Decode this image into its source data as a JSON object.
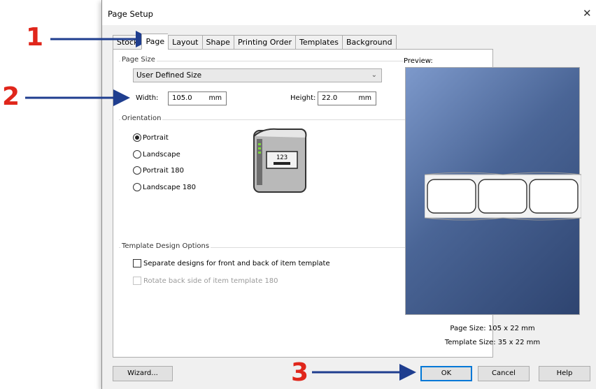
{
  "dialog": {
    "title": "Page Setup",
    "close_glyph": "✕"
  },
  "tabs": [
    {
      "label": "Stock",
      "active": false
    },
    {
      "label": "Page",
      "active": true
    },
    {
      "label": "Layout",
      "active": false
    },
    {
      "label": "Shape",
      "active": false
    },
    {
      "label": "Printing Order",
      "active": false
    },
    {
      "label": "Templates",
      "active": false
    },
    {
      "label": "Background",
      "active": false
    }
  ],
  "page_size": {
    "group_label": "Page Size",
    "selected": "User Defined Size",
    "width_label": "Width:",
    "width_value": "105.0",
    "width_unit": "mm",
    "height_label": "Height:",
    "height_value": "22.0",
    "height_unit": "mm"
  },
  "orientation": {
    "group_label": "Orientation",
    "options": [
      {
        "label": "Portrait",
        "selected": true
      },
      {
        "label": "Landscape",
        "selected": false
      },
      {
        "label": "Portrait 180",
        "selected": false
      },
      {
        "label": "Landscape 180",
        "selected": false
      }
    ],
    "printer_icon_label": "123"
  },
  "template_design": {
    "group_label": "Template Design Options",
    "separate_designs": "Separate designs for front and back of item template",
    "rotate_back": "Rotate back side of item template 180"
  },
  "preview": {
    "label": "Preview:",
    "page_size": "Page Size:  105 x 22 mm",
    "template_size": "Template Size:  35 x 22 mm"
  },
  "buttons": {
    "wizard": "Wizard...",
    "ok": "OK",
    "cancel": "Cancel",
    "help": "Help"
  },
  "annotations": {
    "one": "1",
    "two": "2",
    "three": "3",
    "color": "#e0261b",
    "arrow_color": "#1f3e8f"
  }
}
